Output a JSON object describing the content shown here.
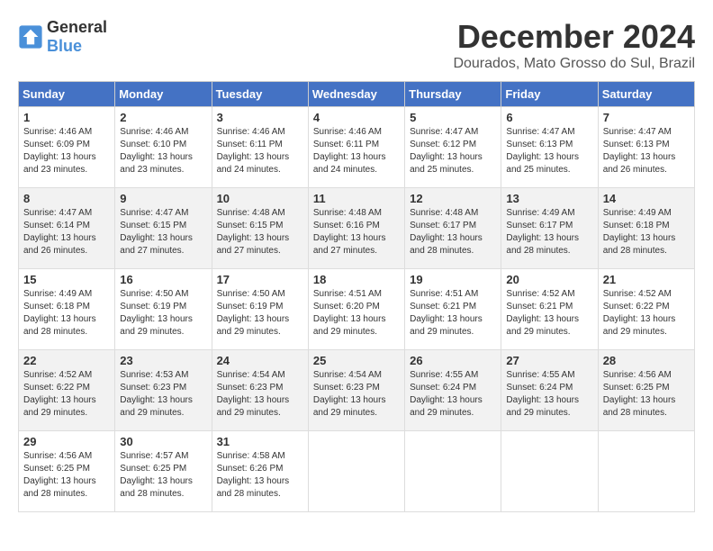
{
  "header": {
    "logo_general": "General",
    "logo_blue": "Blue",
    "month_title": "December 2024",
    "location": "Dourados, Mato Grosso do Sul, Brazil"
  },
  "calendar": {
    "days_of_week": [
      "Sunday",
      "Monday",
      "Tuesday",
      "Wednesday",
      "Thursday",
      "Friday",
      "Saturday"
    ],
    "weeks": [
      [
        {
          "day": "1",
          "sunrise": "Sunrise: 4:46 AM",
          "sunset": "Sunset: 6:09 PM",
          "daylight": "Daylight: 13 hours and 23 minutes."
        },
        {
          "day": "2",
          "sunrise": "Sunrise: 4:46 AM",
          "sunset": "Sunset: 6:10 PM",
          "daylight": "Daylight: 13 hours and 23 minutes."
        },
        {
          "day": "3",
          "sunrise": "Sunrise: 4:46 AM",
          "sunset": "Sunset: 6:11 PM",
          "daylight": "Daylight: 13 hours and 24 minutes."
        },
        {
          "day": "4",
          "sunrise": "Sunrise: 4:46 AM",
          "sunset": "Sunset: 6:11 PM",
          "daylight": "Daylight: 13 hours and 24 minutes."
        },
        {
          "day": "5",
          "sunrise": "Sunrise: 4:47 AM",
          "sunset": "Sunset: 6:12 PM",
          "daylight": "Daylight: 13 hours and 25 minutes."
        },
        {
          "day": "6",
          "sunrise": "Sunrise: 4:47 AM",
          "sunset": "Sunset: 6:13 PM",
          "daylight": "Daylight: 13 hours and 25 minutes."
        },
        {
          "day": "7",
          "sunrise": "Sunrise: 4:47 AM",
          "sunset": "Sunset: 6:13 PM",
          "daylight": "Daylight: 13 hours and 26 minutes."
        }
      ],
      [
        {
          "day": "8",
          "sunrise": "Sunrise: 4:47 AM",
          "sunset": "Sunset: 6:14 PM",
          "daylight": "Daylight: 13 hours and 26 minutes."
        },
        {
          "day": "9",
          "sunrise": "Sunrise: 4:47 AM",
          "sunset": "Sunset: 6:15 PM",
          "daylight": "Daylight: 13 hours and 27 minutes."
        },
        {
          "day": "10",
          "sunrise": "Sunrise: 4:48 AM",
          "sunset": "Sunset: 6:15 PM",
          "daylight": "Daylight: 13 hours and 27 minutes."
        },
        {
          "day": "11",
          "sunrise": "Sunrise: 4:48 AM",
          "sunset": "Sunset: 6:16 PM",
          "daylight": "Daylight: 13 hours and 27 minutes."
        },
        {
          "day": "12",
          "sunrise": "Sunrise: 4:48 AM",
          "sunset": "Sunset: 6:17 PM",
          "daylight": "Daylight: 13 hours and 28 minutes."
        },
        {
          "day": "13",
          "sunrise": "Sunrise: 4:49 AM",
          "sunset": "Sunset: 6:17 PM",
          "daylight": "Daylight: 13 hours and 28 minutes."
        },
        {
          "day": "14",
          "sunrise": "Sunrise: 4:49 AM",
          "sunset": "Sunset: 6:18 PM",
          "daylight": "Daylight: 13 hours and 28 minutes."
        }
      ],
      [
        {
          "day": "15",
          "sunrise": "Sunrise: 4:49 AM",
          "sunset": "Sunset: 6:18 PM",
          "daylight": "Daylight: 13 hours and 28 minutes."
        },
        {
          "day": "16",
          "sunrise": "Sunrise: 4:50 AM",
          "sunset": "Sunset: 6:19 PM",
          "daylight": "Daylight: 13 hours and 29 minutes."
        },
        {
          "day": "17",
          "sunrise": "Sunrise: 4:50 AM",
          "sunset": "Sunset: 6:19 PM",
          "daylight": "Daylight: 13 hours and 29 minutes."
        },
        {
          "day": "18",
          "sunrise": "Sunrise: 4:51 AM",
          "sunset": "Sunset: 6:20 PM",
          "daylight": "Daylight: 13 hours and 29 minutes."
        },
        {
          "day": "19",
          "sunrise": "Sunrise: 4:51 AM",
          "sunset": "Sunset: 6:21 PM",
          "daylight": "Daylight: 13 hours and 29 minutes."
        },
        {
          "day": "20",
          "sunrise": "Sunrise: 4:52 AM",
          "sunset": "Sunset: 6:21 PM",
          "daylight": "Daylight: 13 hours and 29 minutes."
        },
        {
          "day": "21",
          "sunrise": "Sunrise: 4:52 AM",
          "sunset": "Sunset: 6:22 PM",
          "daylight": "Daylight: 13 hours and 29 minutes."
        }
      ],
      [
        {
          "day": "22",
          "sunrise": "Sunrise: 4:52 AM",
          "sunset": "Sunset: 6:22 PM",
          "daylight": "Daylight: 13 hours and 29 minutes."
        },
        {
          "day": "23",
          "sunrise": "Sunrise: 4:53 AM",
          "sunset": "Sunset: 6:23 PM",
          "daylight": "Daylight: 13 hours and 29 minutes."
        },
        {
          "day": "24",
          "sunrise": "Sunrise: 4:54 AM",
          "sunset": "Sunset: 6:23 PM",
          "daylight": "Daylight: 13 hours and 29 minutes."
        },
        {
          "day": "25",
          "sunrise": "Sunrise: 4:54 AM",
          "sunset": "Sunset: 6:23 PM",
          "daylight": "Daylight: 13 hours and 29 minutes."
        },
        {
          "day": "26",
          "sunrise": "Sunrise: 4:55 AM",
          "sunset": "Sunset: 6:24 PM",
          "daylight": "Daylight: 13 hours and 29 minutes."
        },
        {
          "day": "27",
          "sunrise": "Sunrise: 4:55 AM",
          "sunset": "Sunset: 6:24 PM",
          "daylight": "Daylight: 13 hours and 29 minutes."
        },
        {
          "day": "28",
          "sunrise": "Sunrise: 4:56 AM",
          "sunset": "Sunset: 6:25 PM",
          "daylight": "Daylight: 13 hours and 28 minutes."
        }
      ],
      [
        {
          "day": "29",
          "sunrise": "Sunrise: 4:56 AM",
          "sunset": "Sunset: 6:25 PM",
          "daylight": "Daylight: 13 hours and 28 minutes."
        },
        {
          "day": "30",
          "sunrise": "Sunrise: 4:57 AM",
          "sunset": "Sunset: 6:25 PM",
          "daylight": "Daylight: 13 hours and 28 minutes."
        },
        {
          "day": "31",
          "sunrise": "Sunrise: 4:58 AM",
          "sunset": "Sunset: 6:26 PM",
          "daylight": "Daylight: 13 hours and 28 minutes."
        },
        null,
        null,
        null,
        null
      ]
    ]
  }
}
